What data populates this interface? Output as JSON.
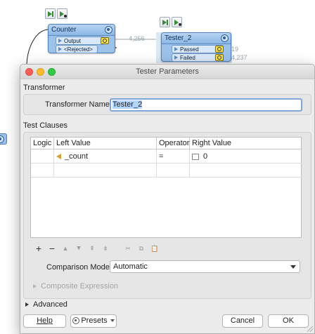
{
  "canvas": {
    "counter": {
      "title": "Counter",
      "ports": [
        "Output",
        "<Rejected>"
      ],
      "output_count": "4,256"
    },
    "tester": {
      "title": "Tester_2",
      "ports": [
        "Passed",
        "Failed"
      ],
      "passed_count": "19",
      "failed_count": "4,237"
    }
  },
  "dialog": {
    "title": "Tester Parameters",
    "transformer_section": "Transformer",
    "name_label": "Transformer Name:",
    "name_value": "Tester_2",
    "test_clauses_section": "Test Clauses",
    "table": {
      "headers": [
        "Logic",
        "Left Value",
        "Operator",
        "Right Value"
      ],
      "rows": [
        {
          "logic": "",
          "left": "_count",
          "operator": "=",
          "right": "0"
        }
      ]
    },
    "edit_tools": [
      "+",
      "−",
      "▲",
      "▲",
      "⇞",
      "⇟",
      "✂",
      "⧉",
      "📋"
    ],
    "comparison_mode_label": "Comparison Mode:",
    "comparison_mode_value": "Automatic",
    "composite_expression": "Composite Expression",
    "advanced": "Advanced",
    "buttons": {
      "help": "Help",
      "presets": "Presets",
      "cancel": "Cancel",
      "ok": "OK"
    }
  },
  "colors": {
    "transformer_fill": "#9cc2ea",
    "selection_highlight": "#b4d5fe",
    "focus_ring": "#7fa6d9"
  }
}
